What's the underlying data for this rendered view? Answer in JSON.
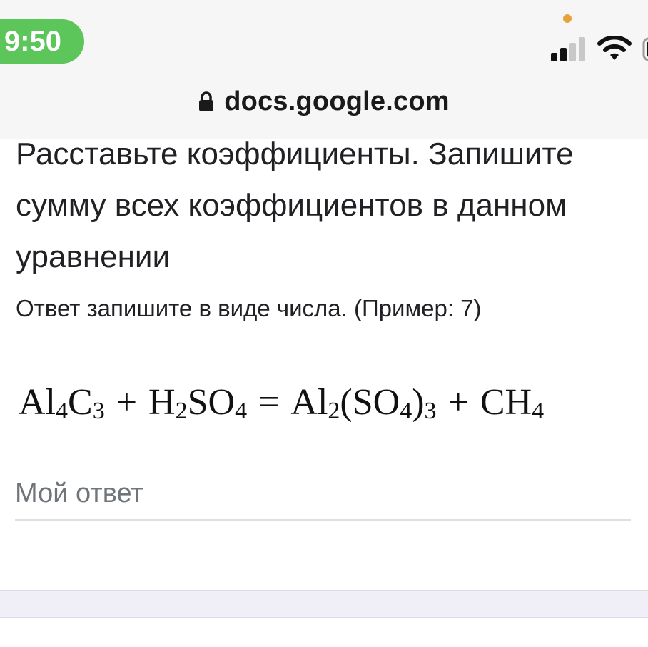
{
  "status_bar": {
    "time": "9:50",
    "icons": [
      "orange-dot-indicator",
      "signal-icon",
      "wifi-icon",
      "battery-icon"
    ]
  },
  "browser": {
    "url": "docs.google.com",
    "lock_icon": "lock-icon"
  },
  "question": {
    "title": "Расставьте коэффициенты. Запишите сумму всех коэффициентов в данном уравнении",
    "hint": "Ответ запишите в виде числа. (Пример: 7)",
    "equation": {
      "plus": "+",
      "equals": "=",
      "terms": {
        "al4c3": {
          "al": "Al",
          "al_sub": "4",
          "c": "C",
          "c_sub": "3"
        },
        "h2so4": {
          "h": "H",
          "h_sub": "2",
          "so": "SO",
          "o_sub": "4"
        },
        "al2so43": {
          "al": "Al",
          "al_sub": "2",
          "open": "(SO",
          "o_sub": "4",
          "close": ")",
          "group_sub": "3"
        },
        "ch4": {
          "ch": "CH",
          "h_sub": "4"
        }
      }
    }
  },
  "answer": {
    "placeholder": "Мой ответ",
    "value": ""
  },
  "colors": {
    "status_time_bg": "#5cc65a",
    "header_bg": "#f6f6f6",
    "text": "#202124",
    "placeholder": "#70757a",
    "section_bg": "#f0eef7"
  }
}
